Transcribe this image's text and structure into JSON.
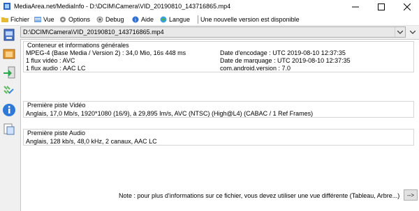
{
  "window": {
    "title": "MediaArea.net/MediaInfo - D:\\DCIM\\Camera\\VID_20190810_143716865.mp4",
    "app_icon": "mediainfo-app-icon",
    "controls": {
      "minimize": "─",
      "maximize": "☐",
      "close": "✕"
    }
  },
  "menu": {
    "items": [
      {
        "label": "Fichier",
        "icon": "folder-icon"
      },
      {
        "label": "Vue",
        "icon": "view-icon"
      },
      {
        "label": "Options",
        "icon": "options-icon"
      },
      {
        "label": "Debug",
        "icon": "debug-icon"
      },
      {
        "label": "Aide",
        "icon": "help-icon"
      },
      {
        "label": "Langue",
        "icon": "language-icon"
      }
    ],
    "update_notice": "Une nouvelle version est disponible"
  },
  "file_selector": {
    "value": "D:\\DCIM\\Camera\\VID_20190810_143716865.mp4"
  },
  "general": {
    "title": "Conteneur et informations générales",
    "left": [
      "MPEG-4 (Base Media / Version 2) : 34,0 Mio, 16s 448 ms",
      "1 flux vidéo : AVC",
      "1 flux audio : AAC LC"
    ],
    "right": [
      "Date d'encodage : UTC 2019-08-10 12:37:35",
      "Date de marquage : UTC 2019-08-10 12:37:35",
      "com.android.version : 7.0"
    ]
  },
  "video": {
    "title": "Première piste Vidéo",
    "line": "Anglais, 17,0 Mb/s, 1920*1080 (16/9), à 29,895 Im/s, AVC (NTSC) (High@L4) (CABAC / 1 Ref Frames)"
  },
  "audio": {
    "title": "Première piste Audio",
    "line": "Anglais, 128 kb/s, 48,0 kHz, 2 canaux, AAC LC"
  },
  "footer": {
    "note": "Note : pour plus d'informations sur ce fichier, vous devez utiliser une vue différente (Tableau, Arbre...)",
    "button": "-->"
  }
}
